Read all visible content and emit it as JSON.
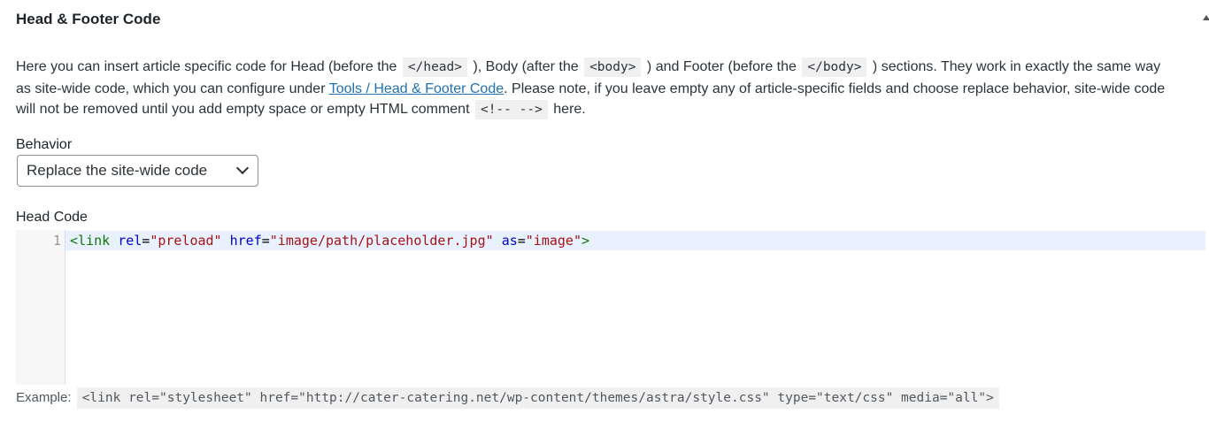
{
  "title": "Head & Footer Code",
  "description": {
    "line1": [
      "Here you can insert article specific code for Head (before the",
      "</head>",
      "), Body (after the",
      "<body>",
      ") and Footer (before the",
      "</body>",
      ") sections. They work in exactly the same way"
    ],
    "line2": [
      "as site-wide code, which you can configure under",
      "Tools / Head & Footer Code",
      ". Please note, if you leave empty any of article-specific fields and choose replace behavior, site-wide code"
    ],
    "line3": [
      "will not be removed until you add empty space or empty HTML comment",
      "<!-- -->",
      "here."
    ]
  },
  "behavior": {
    "label": "Behavior",
    "selected": "Replace the site-wide code"
  },
  "head_code": {
    "label": "Head Code",
    "line_number": "1",
    "tokens": [
      "<link",
      "rel",
      "=",
      "\"preload\"",
      "href",
      "=",
      "\"image/path/placeholder.jpg\"",
      "as",
      "=",
      "\"image\"",
      ">"
    ]
  },
  "example": {
    "label": "Example:",
    "code": "<link rel=\"stylesheet\" href=\"http://cater-catering.net/wp-content/themes/astra/style.css\" type=\"text/css\" media=\"all\">"
  }
}
